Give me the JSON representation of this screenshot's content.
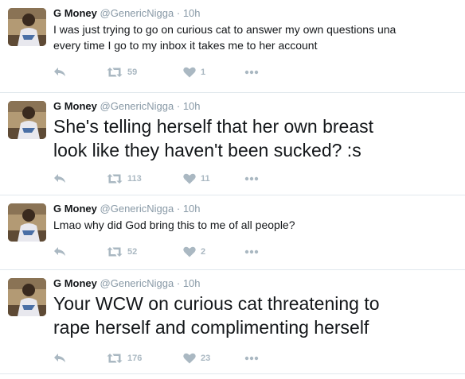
{
  "tweets": [
    {
      "name": "G Money",
      "handle": "@GenericNigga",
      "sep": "·",
      "time": "10h",
      "text_lines": [
        "I was just trying to go on curious cat to answer my own questions una",
        "every time I go to my inbox it takes me to her account"
      ],
      "retweets": "59",
      "likes": "1"
    },
    {
      "name": "G Money",
      "handle": "@GenericNigga",
      "sep": "·",
      "time": "10h",
      "text_lines": [
        "She's telling herself that her own breast",
        "look like they haven't been sucked? :s"
      ],
      "retweets": "113",
      "likes": "11"
    },
    {
      "name": "G Money",
      "handle": "@GenericNigga",
      "sep": "·",
      "time": "10h",
      "text_lines": [
        "Lmao why did God bring this to me of all people?"
      ],
      "retweets": "52",
      "likes": "2"
    },
    {
      "name": "G Money",
      "handle": "@GenericNigga",
      "sep": "·",
      "time": "10h",
      "text_lines": [
        "Your WCW on curious cat threatening to",
        "rape herself and complimenting herself"
      ],
      "retweets": "176",
      "likes": "23"
    }
  ],
  "icons": {
    "reply": "reply-arrow-icon",
    "retweet": "retweet-icon",
    "like": "heart-icon",
    "more": "more-dots-icon"
  },
  "colors": {
    "action_gray": "#aab8c2",
    "meta_gray": "#8899a6",
    "divider": "#e1e8ed"
  }
}
